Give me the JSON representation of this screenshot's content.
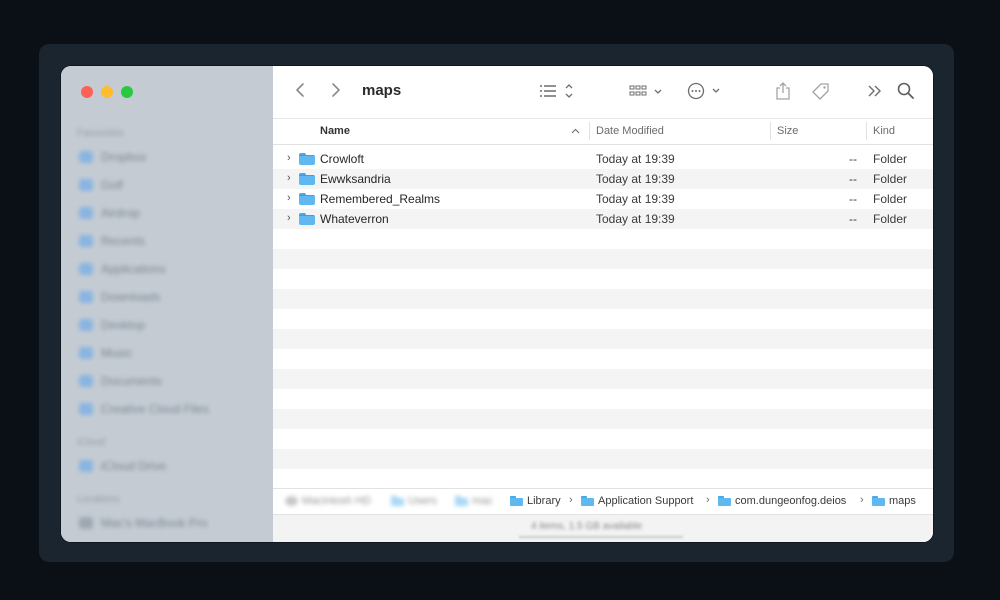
{
  "window": {
    "title": "maps"
  },
  "sidebar": {
    "sections": [
      {
        "label": "Favourites",
        "items": [
          "Dropbox",
          "Golf",
          "Airdrop",
          "Recents",
          "Applications",
          "Downloads",
          "Desktop",
          "Music",
          "Documents",
          "Creative Cloud Files"
        ]
      },
      {
        "label": "iCloud",
        "items": [
          "iCloud Drive"
        ]
      },
      {
        "label": "Locations",
        "items": [
          "Mac's MacBook Pro"
        ]
      }
    ]
  },
  "toolbar": {
    "back_icon": "chevron-left-icon",
    "forward_icon": "chevron-right-icon",
    "list_view_icon": "list-view-icon",
    "group_icon": "grid-group-icon",
    "action_icon": "ellipsis-circle-icon",
    "share_icon": "share-icon",
    "tag_icon": "tag-icon",
    "more_icon": "double-chevron-icon",
    "search_icon": "search-icon"
  },
  "columns": {
    "name": "Name",
    "date": "Date Modified",
    "size": "Size",
    "kind": "Kind"
  },
  "files": [
    {
      "name": "Crowloft",
      "date": "Today at 19:39",
      "size": "--",
      "kind": "Folder"
    },
    {
      "name": "Ewwksandria",
      "date": "Today at 19:39",
      "size": "--",
      "kind": "Folder"
    },
    {
      "name": "Remembered_Realms",
      "date": "Today at 19:39",
      "size": "--",
      "kind": "Folder"
    },
    {
      "name": "Whateverron",
      "date": "Today at 19:39",
      "size": "--",
      "kind": "Folder"
    }
  ],
  "pathbar": {
    "blurred": [
      "Macintosh HD",
      "Users",
      "mac"
    ],
    "crumbs": [
      "Library",
      "Application Support",
      "com.dungeonfog.deios",
      "maps"
    ]
  },
  "statusbar": {
    "text": "4 items, 1.5 GB available"
  },
  "colors": {
    "folder": "#5fb8f0",
    "red": "#fe5f57",
    "yellow": "#febc2e",
    "green": "#28c840",
    "sidebar": "#c4cbd3"
  }
}
